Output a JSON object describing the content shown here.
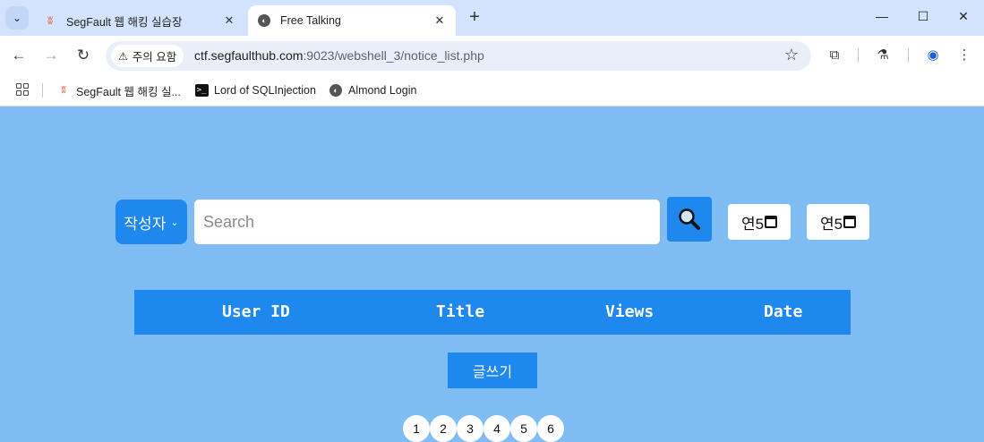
{
  "browser": {
    "tabs": [
      {
        "title": "SegFault 웹 해킹 실습장",
        "active": false,
        "icon": "segfault-logo-icon"
      },
      {
        "title": "Free Talking",
        "active": true,
        "icon": "globe-icon"
      }
    ],
    "address_bar": {
      "security_label": "주의 요함",
      "url_host": "ctf.segfaulthub.com",
      "url_path": ":9023/webshell_3/notice_list.php"
    },
    "bookmarks": [
      {
        "label": "SegFault 웹 해킹 실...",
        "icon": "segfault-logo-icon"
      },
      {
        "label": "Lord of SQLInjection",
        "icon": "terminal-icon"
      },
      {
        "label": "Almond Login",
        "icon": "globe-icon"
      }
    ]
  },
  "search": {
    "filter_label": "작성자",
    "placeholder": "Search",
    "date_from": "연5",
    "date_to": "연5"
  },
  "table": {
    "columns": [
      "User ID",
      "Title",
      "Views",
      "Date"
    ]
  },
  "write_button": "글쓰기",
  "pages": [
    "1",
    "2",
    "3",
    "4",
    "5",
    "6"
  ],
  "colors": {
    "page_bg": "#7fbcf4",
    "accent": "#1e88ef"
  }
}
